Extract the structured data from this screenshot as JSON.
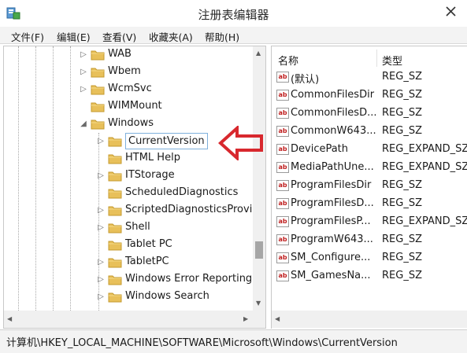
{
  "window": {
    "title": "注册表编辑器"
  },
  "menu": [
    "文件(F)",
    "编辑(E)",
    "查看(V)",
    "收藏夹(A)",
    "帮助(H)"
  ],
  "tree": [
    {
      "label": "WAB",
      "expander": "▷",
      "selected": false
    },
    {
      "label": "Wbem",
      "expander": "▷",
      "selected": false
    },
    {
      "label": "WcmSvc",
      "expander": "▷",
      "selected": false
    },
    {
      "label": "WIMMount",
      "expander": "",
      "selected": false
    },
    {
      "label": "Windows",
      "expander": "◢",
      "selected": false
    },
    {
      "label": "CurrentVersion",
      "expander": "▷",
      "selected": true
    },
    {
      "label": "HTML Help",
      "expander": "",
      "selected": false
    },
    {
      "label": "ITStorage",
      "expander": "▷",
      "selected": false
    },
    {
      "label": "ScheduledDiagnostics",
      "expander": "",
      "selected": false
    },
    {
      "label": "ScriptedDiagnosticsProvi",
      "expander": "▷",
      "selected": false
    },
    {
      "label": "Shell",
      "expander": "▷",
      "selected": false
    },
    {
      "label": "Tablet PC",
      "expander": "",
      "selected": false
    },
    {
      "label": "TabletPC",
      "expander": "▷",
      "selected": false
    },
    {
      "label": "Windows Error Reporting",
      "expander": "▷",
      "selected": false
    },
    {
      "label": "Windows Search",
      "expander": "▷",
      "selected": false
    }
  ],
  "list": {
    "headers": {
      "name": "名称",
      "type": "类型"
    },
    "rows": [
      {
        "name": "(默认)",
        "type": "REG_SZ"
      },
      {
        "name": "CommonFilesDir",
        "type": "REG_SZ"
      },
      {
        "name": "CommonFilesD...",
        "type": "REG_SZ"
      },
      {
        "name": "CommonW643...",
        "type": "REG_SZ"
      },
      {
        "name": "DevicePath",
        "type": "REG_EXPAND_SZ"
      },
      {
        "name": "MediaPathUne...",
        "type": "REG_EXPAND_SZ"
      },
      {
        "name": "ProgramFilesDir",
        "type": "REG_SZ"
      },
      {
        "name": "ProgramFilesD...",
        "type": "REG_SZ"
      },
      {
        "name": "ProgramFilesP...",
        "type": "REG_EXPAND_SZ"
      },
      {
        "name": "ProgramW643...",
        "type": "REG_SZ"
      },
      {
        "name": "SM_Configure...",
        "type": "REG_SZ"
      },
      {
        "name": "SM_GamesNa...",
        "type": "REG_SZ"
      }
    ]
  },
  "status": "计算机\\HKEY_LOCAL_MACHINE\\SOFTWARE\\Microsoft\\Windows\\CurrentVersion",
  "colors": {
    "annotation_arrow": "#d8282e",
    "folder": "#e8c05a",
    "selection_border": "#7fb0dc"
  }
}
